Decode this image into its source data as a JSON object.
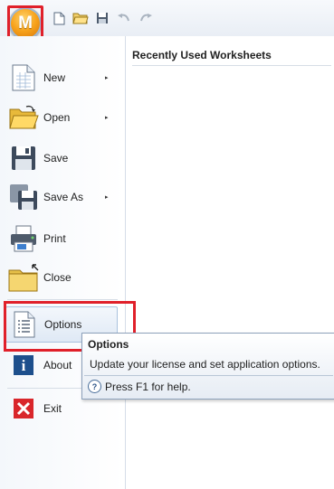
{
  "app": {
    "orb_letter": "M"
  },
  "quick_access": {
    "icons": [
      "new-document-icon",
      "open-folder-icon",
      "save-disk-icon",
      "undo-icon",
      "redo-icon"
    ]
  },
  "menu": {
    "items": [
      {
        "label": "New",
        "icon": "new-document-icon",
        "submenu": true
      },
      {
        "label": "Open",
        "icon": "open-folder-icon",
        "submenu": true
      },
      {
        "label": "Save",
        "icon": "save-disk-icon",
        "submenu": false
      },
      {
        "label": "Save As",
        "icon": "save-as-icon",
        "submenu": true
      },
      {
        "label": "Print",
        "icon": "printer-icon",
        "submenu": false
      },
      {
        "label": "Close",
        "icon": "close-folder-icon",
        "submenu": false
      },
      {
        "label": "Options",
        "icon": "options-list-icon",
        "submenu": false,
        "selected": true
      },
      {
        "label": "About",
        "icon": "info-icon",
        "submenu": false
      },
      {
        "label": "Exit",
        "icon": "exit-x-icon",
        "submenu": false
      }
    ],
    "submenu_arrow": "▸"
  },
  "recent": {
    "header": "Recently Used Worksheets"
  },
  "tooltip": {
    "title": "Options",
    "description": "Update your license and set application options.",
    "help": "Press F1 for help."
  },
  "colors": {
    "highlight": "#e0202a",
    "orb": "#f7a21b",
    "about_blue": "#1d4f8c",
    "exit_red": "#d9262b"
  }
}
